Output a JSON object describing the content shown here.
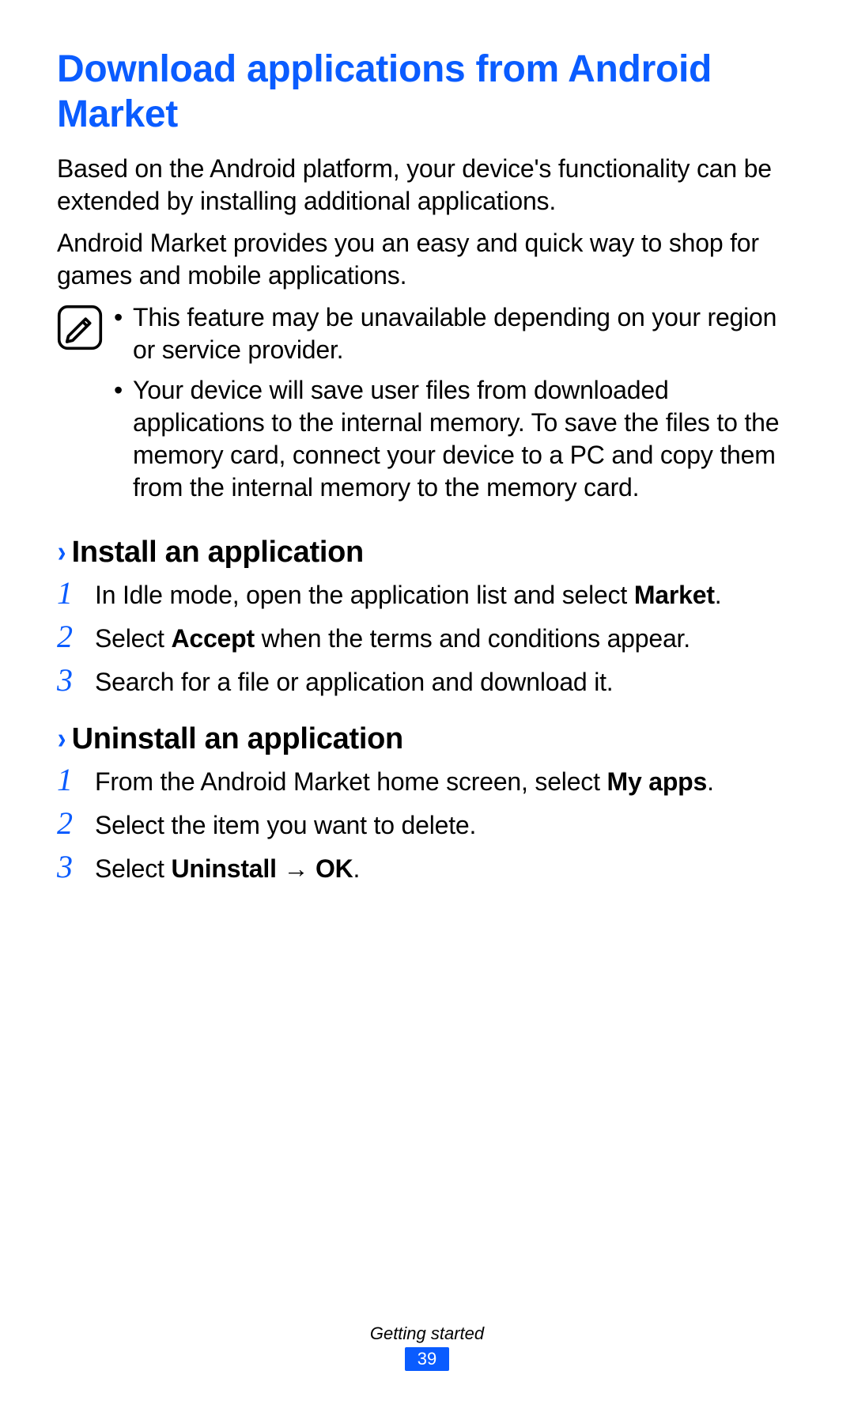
{
  "title": "Download applications from Android Market",
  "intro_p1": "Based on the Android platform, your device's functionality can be extended by installing additional applications.",
  "intro_p2": "Android Market provides you an easy and quick way to shop for games and mobile applications.",
  "note": {
    "icon_name": "note-pencil-icon",
    "bullets": [
      "This feature may be unavailable depending on your region or service provider.",
      "Your device will save user files from downloaded applications to the internal memory. To save the files to the memory card, connect your device to a PC and copy them from the internal memory to the memory card."
    ]
  },
  "sections": [
    {
      "title": "Install an application",
      "steps": [
        {
          "num": "1",
          "pre": "In Idle mode, open the application list and select ",
          "bold": "Market",
          "post": "."
        },
        {
          "num": "2",
          "pre": "Select ",
          "bold": "Accept",
          "post": " when the terms and conditions appear."
        },
        {
          "num": "3",
          "pre": "Search for a file or application and download it.",
          "bold": "",
          "post": ""
        }
      ]
    },
    {
      "title": "Uninstall an application",
      "steps": [
        {
          "num": "1",
          "pre": "From the Android Market home screen, select ",
          "bold": "My apps",
          "post": "."
        },
        {
          "num": "2",
          "pre": "Select the item you want to delete.",
          "bold": "",
          "post": ""
        },
        {
          "num": "3",
          "pre": "Select ",
          "bold": "Uninstall → OK",
          "post": "."
        }
      ]
    }
  ],
  "footer": {
    "section_label": "Getting started",
    "page_number": "39"
  },
  "colors": {
    "accent": "#0a5cff"
  }
}
